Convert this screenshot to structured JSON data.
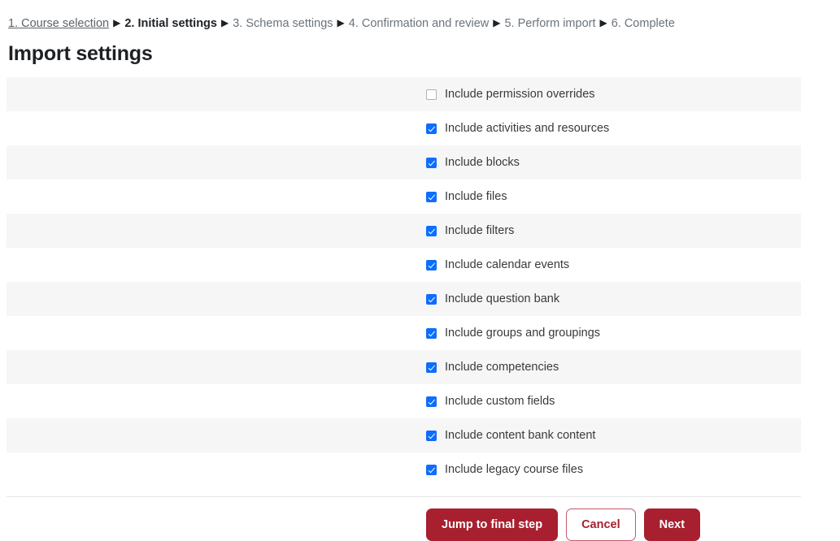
{
  "breadcrumb": {
    "separator": "▶",
    "steps": [
      {
        "label": "1. Course selection",
        "state": "link"
      },
      {
        "label": "2. Initial settings",
        "state": "current"
      },
      {
        "label": "3. Schema settings",
        "state": "upcoming"
      },
      {
        "label": "4. Confirmation and review",
        "state": "upcoming"
      },
      {
        "label": "5. Perform import",
        "state": "upcoming"
      },
      {
        "label": "6. Complete",
        "state": "upcoming"
      }
    ]
  },
  "page": {
    "title": "Import settings"
  },
  "settings": {
    "items": [
      {
        "label": "Include permission overrides",
        "checked": false
      },
      {
        "label": "Include activities and resources",
        "checked": true
      },
      {
        "label": "Include blocks",
        "checked": true
      },
      {
        "label": "Include files",
        "checked": true
      },
      {
        "label": "Include filters",
        "checked": true
      },
      {
        "label": "Include calendar events",
        "checked": true
      },
      {
        "label": "Include question bank",
        "checked": true
      },
      {
        "label": "Include groups and groupings",
        "checked": true
      },
      {
        "label": "Include competencies",
        "checked": true
      },
      {
        "label": "Include custom fields",
        "checked": true
      },
      {
        "label": "Include content bank content",
        "checked": true
      },
      {
        "label": "Include legacy course files",
        "checked": true
      }
    ]
  },
  "actions": {
    "jump_label": "Jump to final step",
    "cancel_label": "Cancel",
    "next_label": "Next"
  },
  "colors": {
    "brand_red": "#a8202f",
    "checkbox_blue": "#0d6efd",
    "stripe_gray": "#f6f6f7",
    "text_dark": "#373a3c",
    "text_muted": "#6a737b"
  }
}
